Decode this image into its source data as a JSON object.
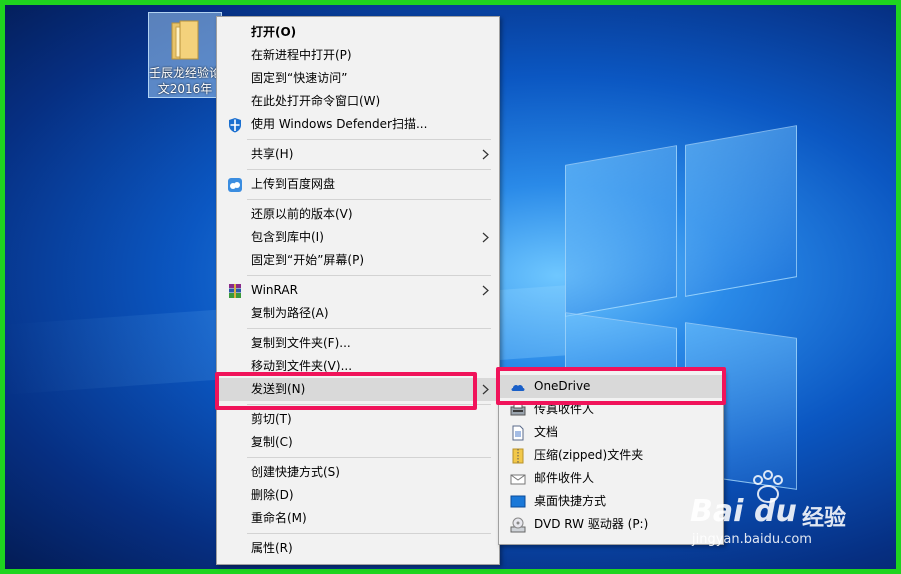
{
  "desktop": {
    "icon_label_line1": "壬辰龙经验论",
    "icon_label_line2": "文2016年"
  },
  "context_menu": {
    "items": [
      {
        "label": "打开(O)"
      },
      {
        "label": "在新进程中打开(P)"
      },
      {
        "label": "固定到“快速访问”"
      },
      {
        "label": "在此处打开命令窗口(W)"
      },
      {
        "label": "使用 Windows Defender扫描..."
      },
      {
        "label": "共享(H)"
      },
      {
        "label": "上传到百度网盘"
      },
      {
        "label": "还原以前的版本(V)"
      },
      {
        "label": "包含到库中(I)"
      },
      {
        "label": "固定到“开始”屏幕(P)"
      },
      {
        "label": "WinRAR"
      },
      {
        "label": "复制为路径(A)"
      },
      {
        "label": "复制到文件夹(F)..."
      },
      {
        "label": "移动到文件夹(V)..."
      },
      {
        "label": "发送到(N)"
      },
      {
        "label": "剪切(T)"
      },
      {
        "label": "复制(C)"
      },
      {
        "label": "创建快捷方式(S)"
      },
      {
        "label": "删除(D)"
      },
      {
        "label": "重命名(M)"
      },
      {
        "label": "属性(R)"
      }
    ]
  },
  "send_to_menu": {
    "items": [
      {
        "label": "OneDrive",
        "icon": "onedrive-icon"
      },
      {
        "label": "传真收件人",
        "icon": "fax-icon"
      },
      {
        "label": "文档",
        "icon": "document-icon"
      },
      {
        "label": "压缩(zipped)文件夹",
        "icon": "zip-folder-icon"
      },
      {
        "label": "邮件收件人",
        "icon": "mail-icon"
      },
      {
        "label": "桌面快捷方式",
        "icon": "desktop-icon"
      },
      {
        "label": "DVD RW 驱动器 (P:)",
        "icon": "dvd-drive-icon"
      }
    ]
  },
  "watermark": {
    "brand": "Bai",
    "brand2": "du",
    "cn": "经验",
    "url": "jingyan.baidu.com"
  },
  "colors": {
    "border_green": "#1fd41f",
    "highlight_red": "#f0135a",
    "menu_bg": "#f2f2f2"
  }
}
